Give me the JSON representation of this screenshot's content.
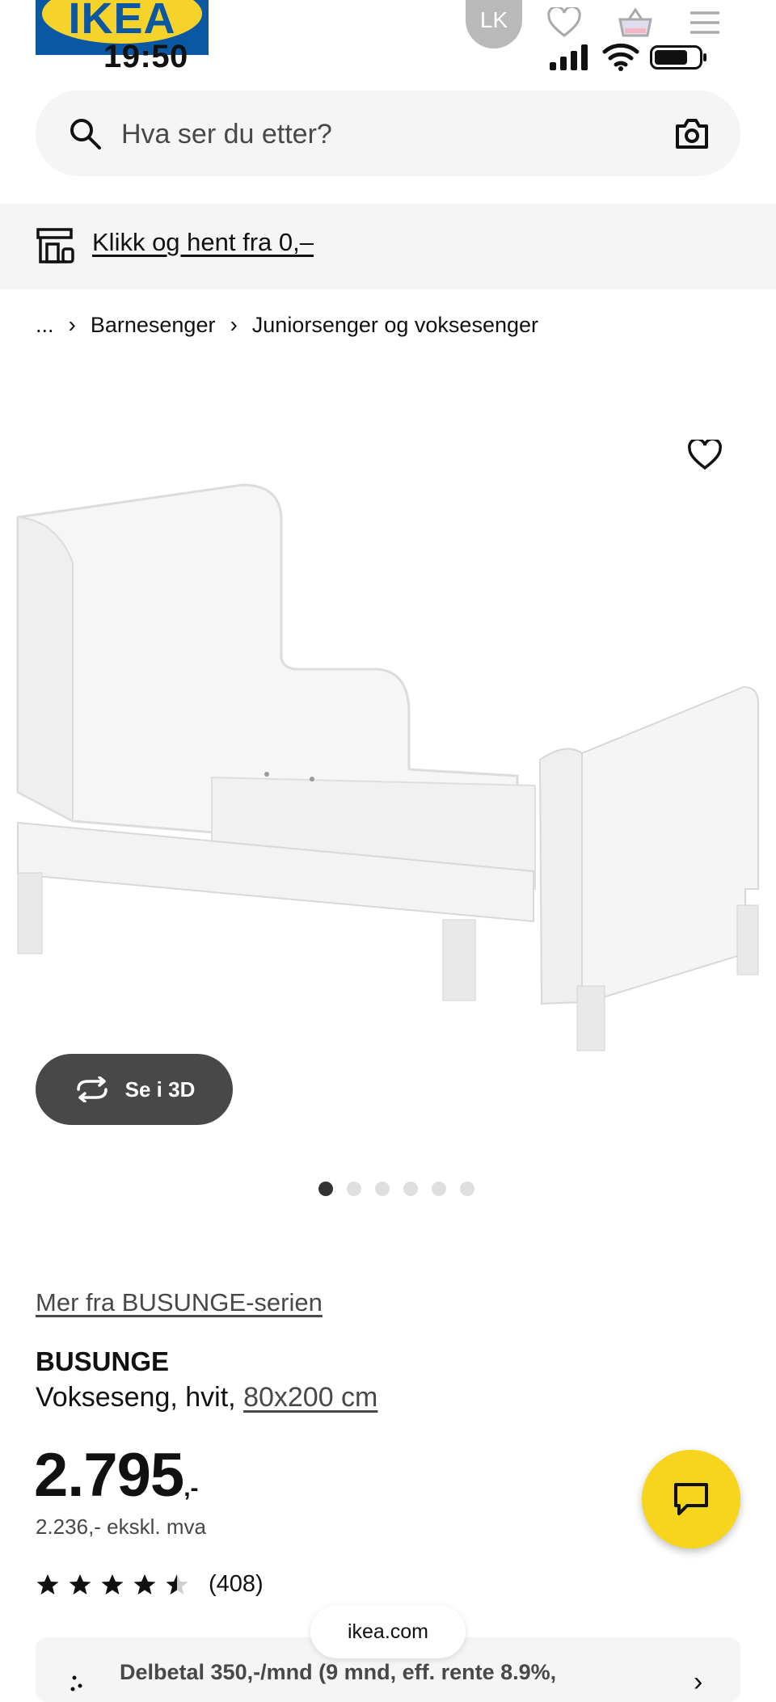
{
  "header": {
    "logo_text": "IKEA",
    "time": "19:50",
    "avatar_initials": "LK"
  },
  "search": {
    "placeholder": "Hva ser du etter?"
  },
  "banner": {
    "link_text": "Klikk og hent fra 0,–"
  },
  "breadcrumb": {
    "items": [
      "...",
      "Barnesenger",
      "Juniorsenger og voksesenger"
    ]
  },
  "product": {
    "view_3d_label": "Se i 3D",
    "image_count": 6,
    "active_image_index": 0,
    "series_link": "Mer fra BUSUNGE-serien",
    "name": "BUSUNGE",
    "description": "Vokseseng, hvit,",
    "size": "80x200 cm",
    "price_main": "2.795",
    "price_suffix": ",-",
    "price_ex_vat": "2.236,- ekskl. mva",
    "rating_value": 4.5,
    "rating_count": "(408)",
    "installment_text": "Delbetal 350,-/mnd (9 mnd, eff. rente 8.9%,"
  },
  "browser": {
    "url": "ikea.com"
  },
  "colors": {
    "ikea_blue": "#0a58a3",
    "ikea_yellow": "#f6d32a",
    "chat_yellow": "#f7d51d",
    "dark_button": "#484848",
    "surface_gray": "#f5f5f5"
  },
  "icons": {
    "search": "search-icon",
    "camera": "camera-icon",
    "store": "store-icon",
    "favorite": "heart-icon",
    "basket": "basket-icon",
    "menu": "menu-icon",
    "chat": "chat-icon",
    "rotate": "rotate-3d-icon"
  }
}
